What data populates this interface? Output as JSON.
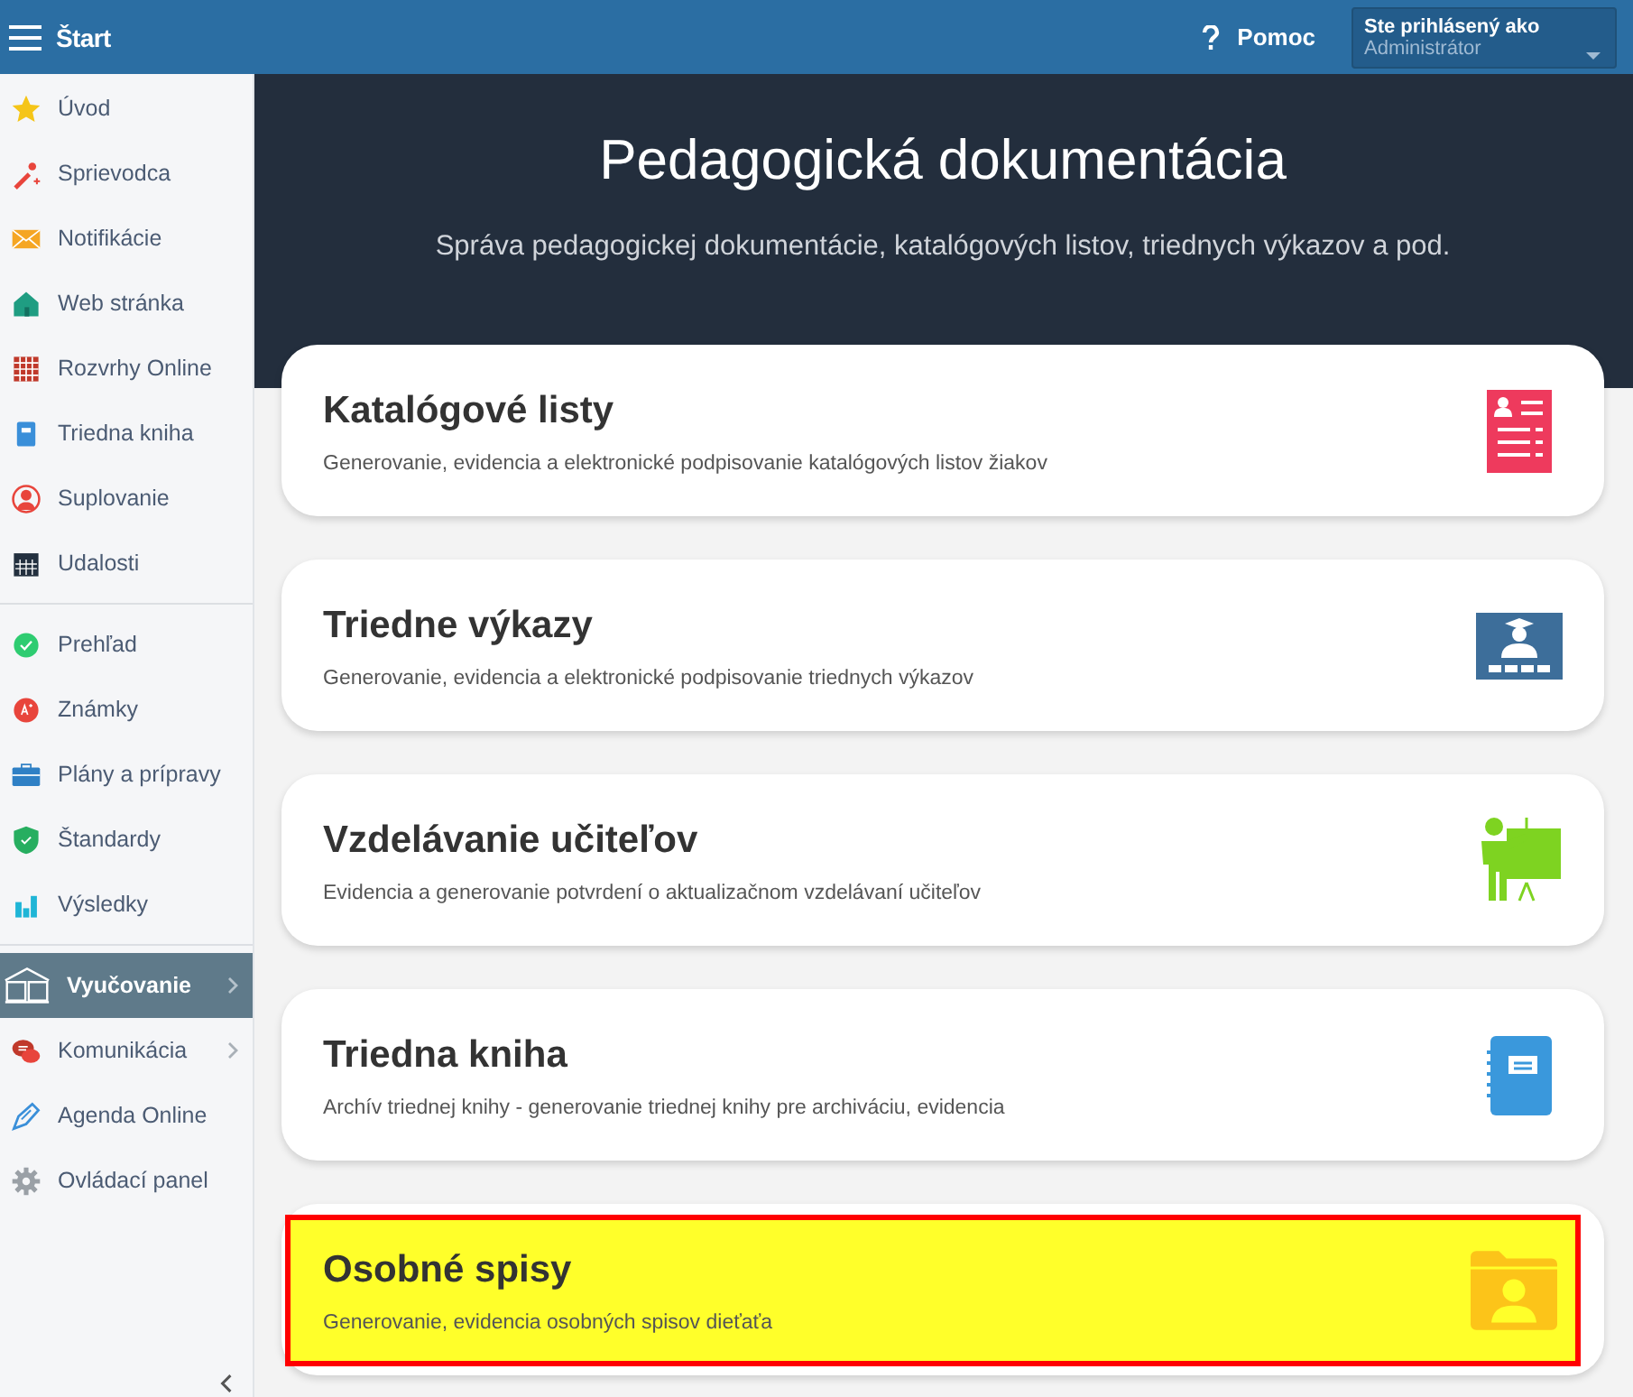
{
  "header": {
    "title": "Štart",
    "help": "Pomoc",
    "user_label": "Ste prihlásený ako",
    "user_name": "Administrátor"
  },
  "sidebar": {
    "groups": [
      {
        "items": [
          {
            "label": "Úvod",
            "selected": false,
            "submenu": false
          },
          {
            "label": "Sprievodca",
            "selected": false,
            "submenu": false
          },
          {
            "label": "Notifikácie",
            "selected": false,
            "submenu": false
          },
          {
            "label": "Web stránka",
            "selected": false,
            "submenu": false
          },
          {
            "label": "Rozvrhy Online",
            "selected": false,
            "submenu": false
          },
          {
            "label": "Triedna kniha",
            "selected": false,
            "submenu": false
          },
          {
            "label": "Suplovanie",
            "selected": false,
            "submenu": false
          },
          {
            "label": "Udalosti",
            "selected": false,
            "submenu": false
          }
        ]
      },
      {
        "items": [
          {
            "label": "Prehľad",
            "selected": false,
            "submenu": false
          },
          {
            "label": "Známky",
            "selected": false,
            "submenu": false
          },
          {
            "label": "Plány a prípravy",
            "selected": false,
            "submenu": false
          },
          {
            "label": "Štandardy",
            "selected": false,
            "submenu": false
          },
          {
            "label": "Výsledky",
            "selected": false,
            "submenu": false
          }
        ]
      },
      {
        "items": [
          {
            "label": "Vyučovanie",
            "selected": true,
            "submenu": true
          },
          {
            "label": "Komunikácia",
            "selected": false,
            "submenu": true
          },
          {
            "label": "Agenda Online",
            "selected": false,
            "submenu": false
          },
          {
            "label": "Ovládací panel",
            "selected": false,
            "submenu": false
          }
        ]
      }
    ]
  },
  "hero": {
    "title": "Pedagogická dokumentácia",
    "subtitle": "Správa pedagogickej dokumentácie, katalógových listov, triednych výkazov a pod."
  },
  "cards": [
    {
      "title": "Katalógové listy",
      "description": "Generovanie, evidencia a elektronické podpisovanie katalógových listov žiakov",
      "highlighted": false
    },
    {
      "title": "Triedne výkazy",
      "description": "Generovanie, evidencia a elektronické podpisovanie triednych výkazov",
      "highlighted": false
    },
    {
      "title": "Vzdelávanie učiteľov",
      "description": "Evidencia a generovanie potvrdení o aktualizačnom vzdelávaní učiteľov",
      "highlighted": false
    },
    {
      "title": "Triedna kniha",
      "description": "Archív triednej knihy - generovanie triednej knihy pre archiváciu, evidencia",
      "highlighted": false
    },
    {
      "title": "Osobné spisy",
      "description": "Generovanie, evidencia osobných spisov dieťaťa",
      "highlighted": true
    }
  ]
}
